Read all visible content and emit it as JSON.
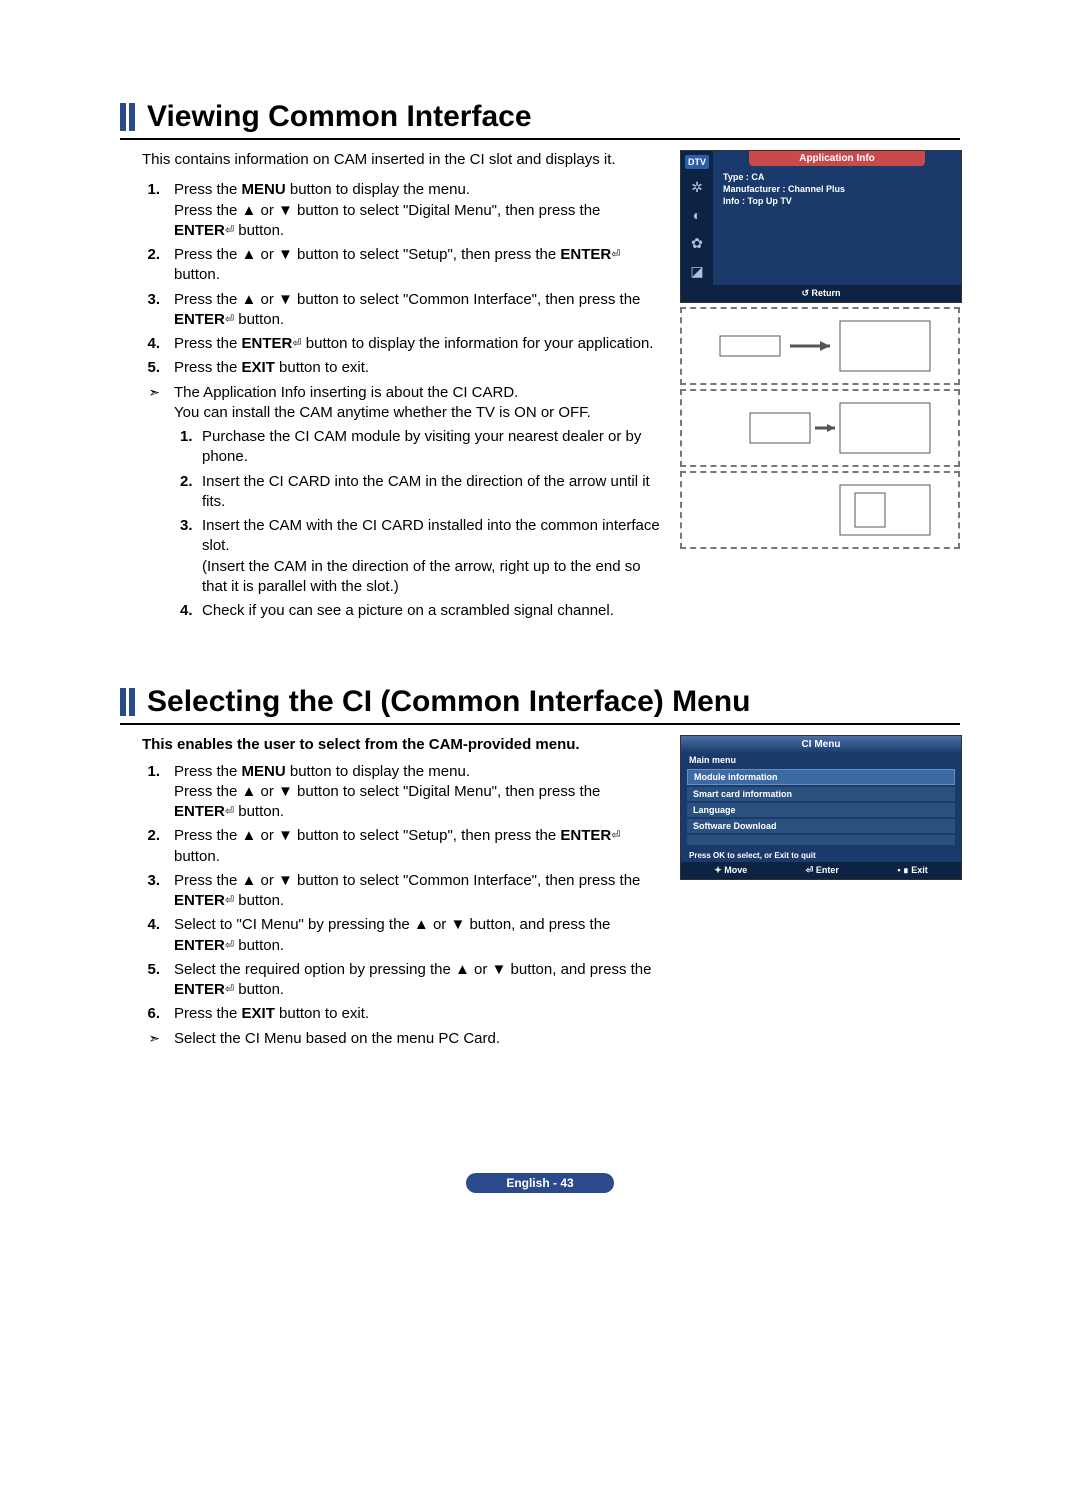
{
  "section1": {
    "title": "Viewing Common Interface",
    "intro": "This contains information on CAM inserted in the CI slot and displays it.",
    "steps": [
      {
        "n": "1.",
        "parts": [
          "Press the ",
          "MENU",
          " button to display the menu.\nPress the ▲ or ▼ button to select \"Digital Menu\", then press the ",
          "ENTER",
          " button."
        ]
      },
      {
        "n": "2.",
        "parts": [
          "Press the ▲ or ▼ button to select \"Setup\", then press the ",
          "ENTER",
          " button."
        ]
      },
      {
        "n": "3.",
        "parts": [
          "Press the ▲ or ▼ button to select \"Common Interface\", then press the ",
          "ENTER",
          " button."
        ]
      },
      {
        "n": "4.",
        "parts": [
          "Press the ",
          "ENTER",
          " button to display the information for your application."
        ]
      },
      {
        "n": "5.",
        "parts": [
          "Press the ",
          "EXIT",
          " button to exit."
        ]
      }
    ],
    "note_lead": "The Application Info inserting is about the CI CARD.\nYou can install the CAM anytime whether the TV is ON or OFF.",
    "substeps": [
      {
        "n": "1.",
        "t": "Purchase the CI CAM module by visiting your nearest dealer or by phone."
      },
      {
        "n": "2.",
        "t": "Insert the CI CARD into the CAM in the direction of the arrow until it fits."
      },
      {
        "n": "3.",
        "t": "Insert the CAM with the CI CARD installed into the common interface slot.\n(Insert the CAM in the direction of the arrow, right up to the end so that it is parallel with the slot.)"
      },
      {
        "n": "4.",
        "t": "Check if you can see a picture on a scrambled signal channel."
      }
    ],
    "osd": {
      "dtv": "DTV",
      "tab": "Application Info",
      "lines": [
        "Type : CA",
        "Manufacturer : Channel Plus",
        "Info : Top Up TV"
      ],
      "return": "↺ Return"
    }
  },
  "section2": {
    "title": "Selecting the CI (Common Interface) Menu",
    "intro": "This enables the user to select from the CAM-provided menu.",
    "steps": [
      {
        "n": "1.",
        "parts": [
          "Press the ",
          "MENU",
          " button to display the menu.\nPress the ▲ or ▼ button to select \"Digital Menu\", then press the ",
          "ENTER",
          " button."
        ]
      },
      {
        "n": "2.",
        "parts": [
          "Press the ▲ or ▼ button to select \"Setup\", then press the ",
          "ENTER",
          " button."
        ]
      },
      {
        "n": "3.",
        "parts": [
          "Press the ▲ or ▼ button to select \"Common Interface\", then press the ",
          "ENTER",
          " button."
        ]
      },
      {
        "n": "4.",
        "parts": [
          "Select to \"CI Menu\" by pressing the ▲ or ▼ button, and press the ",
          "ENTER",
          " button."
        ]
      },
      {
        "n": "5.",
        "parts": [
          "Select the required option by pressing the ▲ or ▼ button, and press the ",
          "ENTER",
          " button."
        ]
      },
      {
        "n": "6.",
        "parts": [
          "Press the ",
          "EXIT",
          " button to exit."
        ]
      }
    ],
    "note": "Select the CI Menu based on the menu PC Card.",
    "osd": {
      "title": "CI Menu",
      "main": "Main menu",
      "items": [
        "Module information",
        "Smart card information",
        "Language",
        "Software Download"
      ],
      "prompt": "Press OK to select, or Exit to quit",
      "footer": {
        "move": "✦ Move",
        "enter": "⏎ Enter",
        "exit": "• ∎ Exit"
      }
    }
  },
  "footer": "English - 43",
  "enter_glyph": "⏎"
}
